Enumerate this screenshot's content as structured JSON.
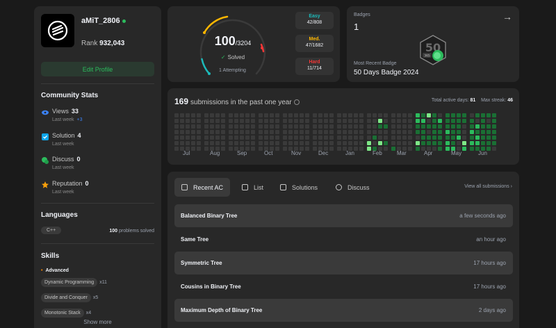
{
  "profile": {
    "username": "aMiT_2806",
    "rank_label": "Rank",
    "rank_value": "932,043",
    "edit_button": "Edit Profile"
  },
  "community": {
    "title": "Community Stats",
    "stats": [
      {
        "name": "Views",
        "value": "33",
        "sub": "Last week",
        "delta": "+3",
        "color": "#3b82f6"
      },
      {
        "name": "Solution",
        "value": "4",
        "sub": "Last week",
        "delta": "",
        "color": "#0ea5e9"
      },
      {
        "name": "Discuss",
        "value": "0",
        "sub": "Last week",
        "delta": "",
        "color": "#2cbb5d"
      },
      {
        "name": "Reputation",
        "value": "0",
        "sub": "Last week",
        "delta": "",
        "color": "#f59e0b"
      }
    ]
  },
  "languages": {
    "title": "Languages",
    "items": [
      {
        "name": "C++",
        "count": "100",
        "suffix": "problems solved"
      }
    ]
  },
  "skills": {
    "title": "Skills",
    "tier": "Advanced",
    "items": [
      {
        "name": "Dynamic Programming",
        "count": "x11"
      },
      {
        "name": "Divide and Conquer",
        "count": "x5"
      },
      {
        "name": "Monotonic Stack",
        "count": "x4"
      }
    ],
    "show_more": "Show more"
  },
  "solved": {
    "solved": "100",
    "total": "/3204",
    "label": "Solved",
    "attempting": "1 Attempting",
    "difficulties": [
      {
        "name": "Easy",
        "value": "42/808",
        "color": "#1cbaba"
      },
      {
        "name": "Med.",
        "value": "47/1682",
        "color": "#ffb700"
      },
      {
        "name": "Hard",
        "value": "11/714",
        "color": "#f63737"
      }
    ]
  },
  "badges": {
    "title": "Badges",
    "count": "1",
    "recent_label": "Most Recent Badge",
    "recent_name": "50 Days Badge 2024",
    "badge_icon": "50-days-badge-icon",
    "badge_text": "365"
  },
  "activity": {
    "count": "169",
    "label": "submissions in the past one year",
    "active_days_label": "Total active days:",
    "active_days": "81",
    "max_streak_label": "Max streak:",
    "max_streak": "46",
    "months": [
      "Jul",
      "Aug",
      "Sep",
      "Oct",
      "Nov",
      "Dec",
      "Jan",
      "Feb",
      "Mar",
      "Apr",
      "May",
      "Jun"
    ]
  },
  "recent": {
    "tabs": [
      {
        "label": "Recent AC",
        "icon": "list-check-icon"
      },
      {
        "label": "List",
        "icon": "document-icon"
      },
      {
        "label": "Solutions",
        "icon": "checkbox-icon"
      },
      {
        "label": "Discuss",
        "icon": "chat-icon"
      }
    ],
    "view_all": "View all submissions",
    "rows": [
      {
        "title": "Balanced Binary Tree",
        "time": "a few seconds ago"
      },
      {
        "title": "Same Tree",
        "time": "an hour ago"
      },
      {
        "title": "Symmetric Tree",
        "time": "17 hours ago"
      },
      {
        "title": "Cousins in Binary Tree",
        "time": "17 hours ago"
      },
      {
        "title": "Maximum Depth of Binary Tree",
        "time": "2 days ago"
      }
    ]
  }
}
